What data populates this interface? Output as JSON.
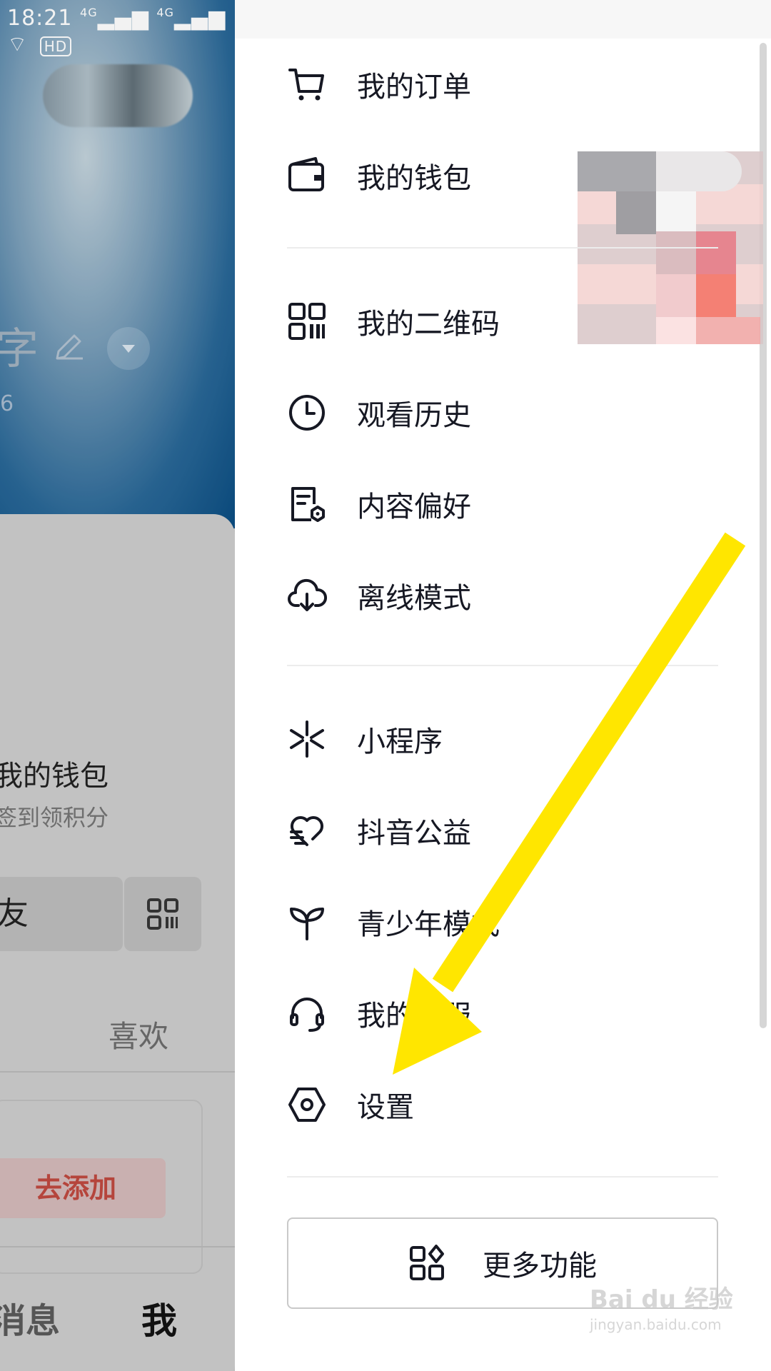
{
  "status_bar": {
    "time": "18:21",
    "net1": "4G",
    "net2": "4G",
    "hd": "HD"
  },
  "left_page": {
    "name_partial": "字",
    "number_partial": "6",
    "wallet_title": "我的钱包",
    "wallet_sub": "签到领积分",
    "friend_button": "友",
    "like_tab": "喜欢",
    "add_button": "去添加",
    "tab_messages": "消息",
    "tab_me": "我"
  },
  "drawer": {
    "section1": [
      {
        "label": "我的订单",
        "icon": "cart-icon"
      },
      {
        "label": "我的钱包",
        "icon": "wallet-icon"
      }
    ],
    "section2": [
      {
        "label": "我的二维码",
        "icon": "qr-code-icon"
      },
      {
        "label": "观看历史",
        "icon": "clock-icon"
      },
      {
        "label": "内容偏好",
        "icon": "content-preference-icon"
      },
      {
        "label": "离线模式",
        "icon": "cloud-download-icon"
      }
    ],
    "section3": [
      {
        "label": "小程序",
        "icon": "mini-program-icon"
      },
      {
        "label": "抖音公益",
        "icon": "charity-heart-icon"
      },
      {
        "label": "青少年模式",
        "icon": "sprout-icon"
      },
      {
        "label": "我的客服",
        "icon": "headset-icon"
      },
      {
        "label": "设置",
        "icon": "settings-hexagon-icon"
      }
    ],
    "more_button": "更多功能"
  },
  "watermark": {
    "brand": "Bai du 经验",
    "url": "jingyan.baidu.com"
  },
  "colors": {
    "arrow": "#FFE600",
    "drawer_bg": "#FFFFFF",
    "dim_overlay": "#BCBCBC"
  }
}
